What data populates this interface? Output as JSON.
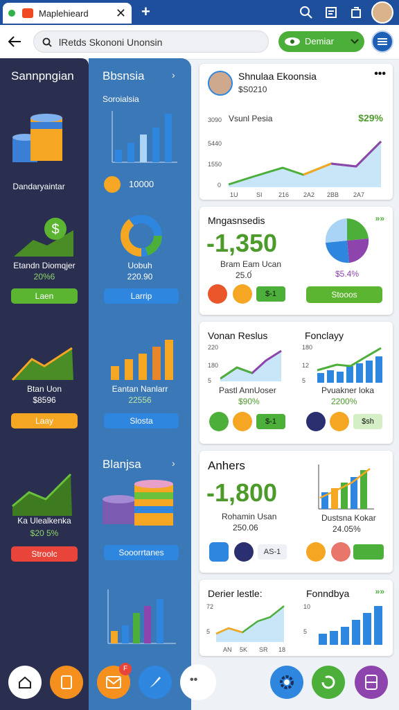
{
  "browser": {
    "tab_title": "Maplehieard",
    "close": "✕",
    "new_tab": "+"
  },
  "toolbar": {
    "search_text": "lRetds Skononi Unonsin",
    "demo_label": "Demiar"
  },
  "col1": {
    "title": "Sannpngian",
    "item1_label": "Dandaryaintar",
    "item2_label": "Etandn Diomqjer",
    "item2_value": "20%6",
    "item2_button": "Laen",
    "item3_label": "Btan Uon",
    "item3_value": "$8596",
    "item3_button": "Laay",
    "item4_label": "Ka Ulealkenka",
    "item4_value": "$20 5%",
    "item4_button": "Stroolc"
  },
  "col2": {
    "title": "Bbsnsia",
    "sub": "Soroialsia",
    "coin_value": "10000",
    "donut_label": "Uobuh",
    "donut_value": "220.90",
    "donut_button": "Larrip",
    "bars_label": "Eantan Nanlarr",
    "bars_value": "22556",
    "bars_button": "Slosta",
    "section2_title": "Blanjsa",
    "stack_button": "Sooorrtanes"
  },
  "card_profile": {
    "name": "Shnulaa Ekoonsia",
    "sub": "$S0210",
    "chart_title": "Vsunl Pesia",
    "chart_pct": "$29%",
    "y_ticks": [
      "3090",
      "5440",
      "1550",
      "0"
    ],
    "x_ticks": [
      "1U",
      "SI",
      "216",
      "2A2",
      "2BB",
      "2A7"
    ]
  },
  "card_mng": {
    "title": "Mngasnsedis",
    "big": "-1,350",
    "label": "Bram Eam Ucan",
    "value": "25.0́",
    "pie_pct": "$5.4%",
    "pill": "$-1",
    "button": "Stooos"
  },
  "card_vonan": {
    "title": "Vonan Reslus",
    "y_ticks": [
      "220",
      "180",
      "5"
    ],
    "label": "Pastl AnnUoser",
    "value": "$90%",
    "pill": "$-1"
  },
  "card_fond": {
    "title": "Fonclayy",
    "y_ticks": [
      "180",
      "12",
      "5"
    ],
    "label": "Pvuakner loka",
    "value": "2200%",
    "pill": "$sh"
  },
  "card_anhers": {
    "title": "Anhers",
    "big": "-1,800",
    "label": "Rohamin Usan",
    "value": "250.06",
    "pill": "AS-1",
    "label2": "Dustsna Kokar",
    "value2": "24.05%"
  },
  "card_bottom": {
    "title1": "Derier lestle:",
    "y1": [
      "72",
      "5"
    ],
    "x1": [
      "AN",
      "5K",
      "SR",
      "18"
    ],
    "title2": "Fonndbya",
    "y2": [
      "10",
      "5"
    ]
  },
  "chart_data": [
    {
      "type": "line",
      "title": "Vsunl Pesia",
      "x": [
        "1U",
        "SI",
        "216",
        "2A2",
        "2BB",
        "2A7"
      ],
      "series": [
        {
          "values": [
            300,
            900,
            1500,
            800,
            1300,
            1100,
            3000
          ]
        }
      ],
      "ylim": [
        0,
        3090
      ]
    },
    {
      "type": "pie",
      "values": [
        30,
        25,
        20,
        25
      ],
      "colors": [
        "#4caf3a",
        "#8e44ad",
        "#2e86de",
        "#a9d4f5"
      ]
    },
    {
      "type": "bar",
      "categories": [
        "1",
        "2",
        "3",
        "4",
        "5"
      ],
      "values": [
        20,
        35,
        30,
        55,
        65
      ]
    }
  ]
}
